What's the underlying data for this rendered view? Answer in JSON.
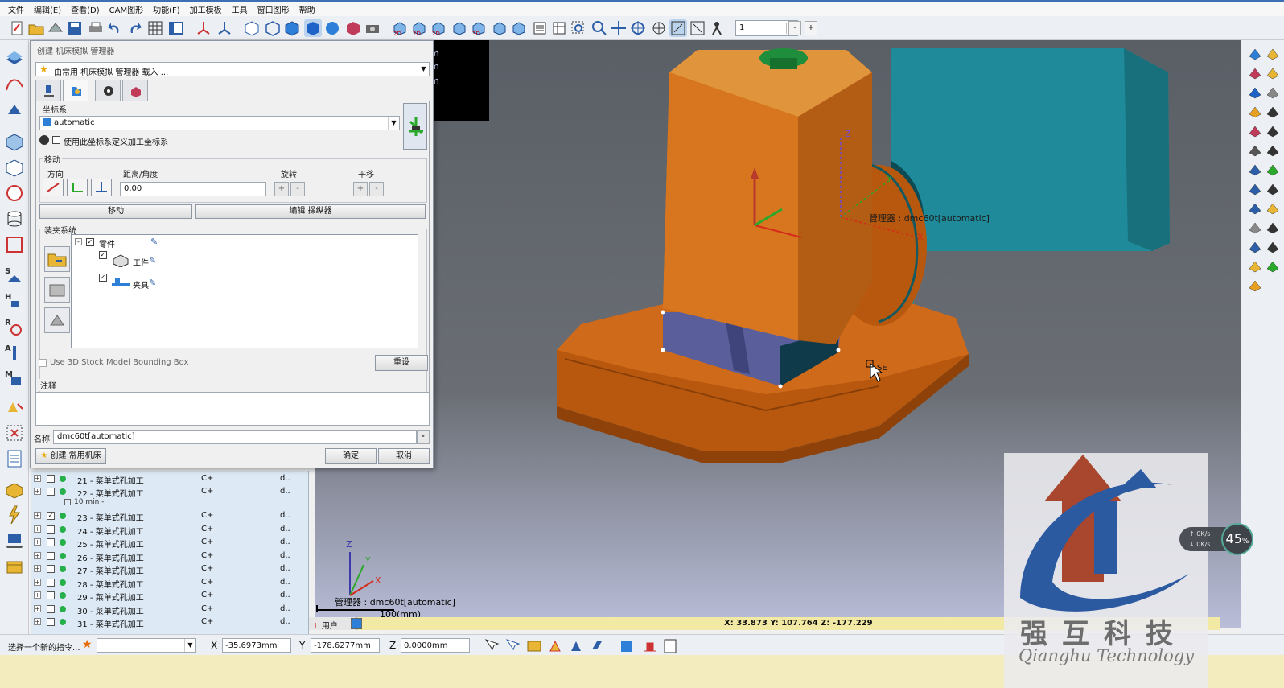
{
  "menu": [
    "文件",
    "编辑(E)",
    "查看(D)",
    "CAM图形",
    "功能(F)",
    "加工模板",
    "工具",
    "窗口图形",
    "帮助"
  ],
  "toolbar": {
    "zoom_value": "1",
    "minus": "-",
    "plus": "+"
  },
  "dialog": {
    "title": "创建 机床模拟 管理器",
    "preset": "由常用 机床模拟 管理器 载入 ...",
    "tabs": [
      "machine-tab",
      "coord-tab",
      "part-tab",
      "stock-tab"
    ],
    "coordinate": {
      "group_label": "坐标系",
      "value": "automatic",
      "use_checkbox_label": "使用此坐标系定义加工坐标系"
    },
    "move": {
      "group_label": "移动",
      "direction_label": "方向",
      "distance_label": "距离/角度",
      "distance_value": "0.00",
      "rotate_label": "旋转",
      "translate_label": "平移",
      "plus": "+",
      "minus": "-",
      "move_button": "移动",
      "edit_manipulator_button": "编辑 操纵器"
    },
    "assembly": {
      "group_label": "装夹系统",
      "root": "零件",
      "children": [
        "工件",
        "夹具"
      ]
    },
    "bounding_box_label": "Use 3D Stock Model Bounding Box",
    "reset_button": "重设",
    "notes_label": "注释",
    "notes_value": "",
    "name_label": "名称",
    "name_value": "dmc60t[automatic]",
    "create_button": "创建 常用机床",
    "ok_button": "确定",
    "cancel_button": "取消"
  },
  "operations": {
    "rows_top": [
      {
        "name": "21 - 菜单式孔加工",
        "col2": "C+",
        "col3": "d..",
        "checked": false
      },
      {
        "name": "22 - 菜单式孔加工",
        "col2": "C+",
        "col3": "d..",
        "checked": false
      }
    ],
    "separator": "10 min -",
    "rows_bottom": [
      {
        "name": "23 - 菜单式孔加工",
        "col2": "C+",
        "col3": "d..",
        "checked": true
      },
      {
        "name": "24 - 菜单式孔加工",
        "col2": "C+",
        "col3": "d..",
        "checked": false
      },
      {
        "name": "25 - 菜单式孔加工",
        "col2": "C+",
        "col3": "d..",
        "checked": false
      },
      {
        "name": "26 - 菜单式孔加工",
        "col2": "C+",
        "col3": "d..",
        "checked": false
      },
      {
        "name": "27 - 菜单式孔加工",
        "col2": "C+",
        "col3": "d..",
        "checked": false
      },
      {
        "name": "28 - 菜单式孔加工",
        "col2": "C+",
        "col3": "d..",
        "checked": false
      },
      {
        "name": "29 - 菜单式孔加工",
        "col2": "C+",
        "col3": "d..",
        "checked": false
      },
      {
        "name": "30 - 菜单式孔加工",
        "col2": "C+",
        "col3": "d..",
        "checked": false
      },
      {
        "name": "31 - 菜单式孔加工",
        "col2": "C+",
        "col3": "d..",
        "checked": false
      }
    ]
  },
  "viewport": {
    "manager_label": "管理器 : dmc60t[automatic]",
    "cursor_label": "SE",
    "triad_label": "管理器 : dmc60t[automatic]",
    "scale_label": "100(mm)",
    "axes": {
      "x": "X",
      "y": "Y",
      "z": "Z"
    },
    "view_tab": "用户",
    "coords": "X:  33.873   Y:  107.764   Z:  -177.229"
  },
  "status": {
    "prompt": "选择一个新的指令...",
    "x_label": "X",
    "x_value": "-35.6973mm",
    "y_label": "Y",
    "y_value": "-178.6277mm",
    "z_label": "Z",
    "z_value": "0.0000mm"
  },
  "speed": {
    "up": "0K/s",
    "down": "0K/s",
    "percent": "45",
    "unit": "%"
  },
  "watermark": {
    "cn": "强互科技",
    "en": "Qianghu Technology"
  },
  "colors": {
    "accent": "#3b6fb6",
    "machine_orange": "#d2752a",
    "machine_teal": "#1f8b9a",
    "viewport": "#666a70"
  }
}
